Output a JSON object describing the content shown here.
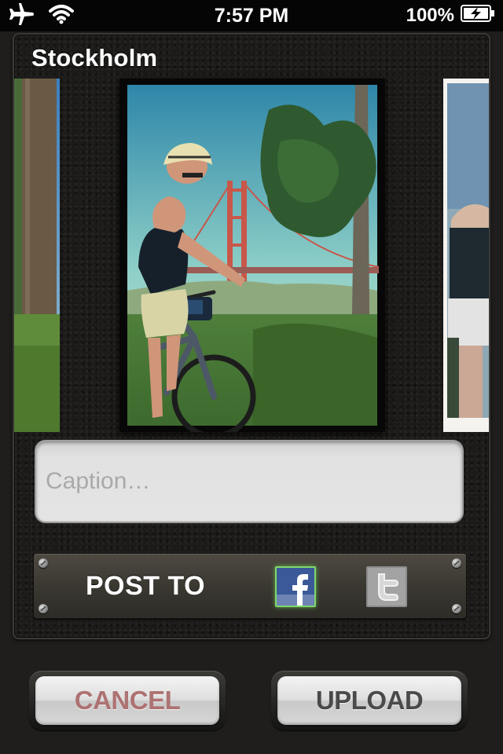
{
  "status_bar": {
    "time": "7:57 PM",
    "battery_percent": "100%",
    "icons": [
      "airplane-icon",
      "wifi-icon",
      "battery-charging-icon"
    ]
  },
  "album": {
    "title": "Stockholm"
  },
  "caption": {
    "placeholder": "Caption…",
    "value": ""
  },
  "post_to": {
    "label": "POST TO",
    "services": [
      {
        "name": "facebook",
        "icon": "facebook-icon",
        "selected": true
      },
      {
        "name": "twitter",
        "icon": "twitter-icon",
        "selected": false
      }
    ]
  },
  "actions": {
    "cancel_label": "CANCEL",
    "upload_label": "UPLOAD"
  },
  "colors": {
    "cancel_text": "#ad7272",
    "upload_text": "#4a4a4a",
    "facebook_blue": "#3b5998",
    "selected_glow": "#7fd86a"
  }
}
